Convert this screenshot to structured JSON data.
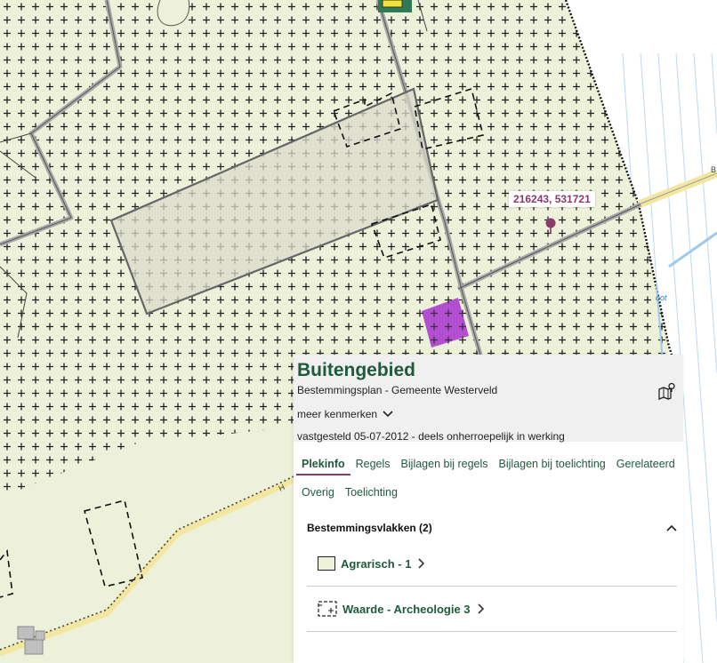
{
  "map": {
    "coordinate_label": "216243, 531721",
    "road_labels": {
      "east_road": "B",
      "southwest_road": "H",
      "water_label": "oot"
    },
    "colors": {
      "agrarisch_fill": "#eef1d9",
      "building_fill": "#b24fd0",
      "boundary": "#111111",
      "road": "#a9a9a9",
      "main_road": "#f2e6a1",
      "water": "#9ec9ee",
      "pin": "#8b3a6b"
    }
  },
  "panel": {
    "title": "Buitengebied",
    "subtitle": "Bestemmingsplan - Gemeente Westerveld",
    "map_icon": "map-pin-icon",
    "meer_kenmerken": "meer kenmerken",
    "vastgesteld": "vastgesteld 05-07-2012 - deels onherroepelijk in werking",
    "tabs": [
      {
        "label": "Plekinfo",
        "active": true
      },
      {
        "label": "Regels"
      },
      {
        "label": "Bijlagen bij regels"
      },
      {
        "label": "Bijlagen bij toelichting"
      },
      {
        "label": "Gerelateerd"
      },
      {
        "label": "Overig"
      },
      {
        "label": "Toelichting"
      }
    ],
    "section": {
      "title": "Bestemmingsvlakken (2)",
      "items": [
        {
          "label": "Agrarisch - 1"
        },
        {
          "label": "Waarde - Archeologie 3"
        }
      ]
    }
  }
}
